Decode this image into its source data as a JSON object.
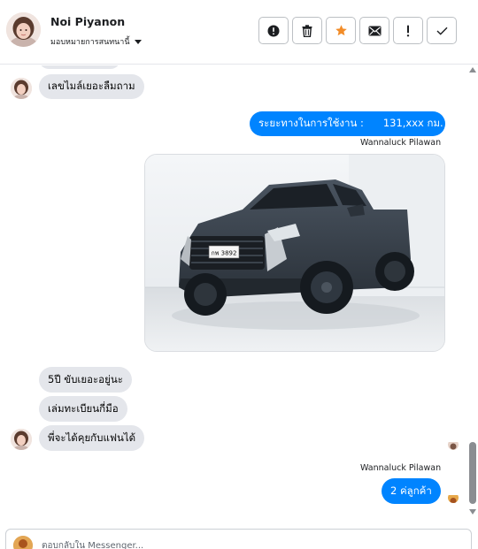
{
  "header": {
    "contact_name": "Noi Piyanon",
    "assign_label": "มอบหมายการสนทนานี้",
    "actions": [
      "exclamation-circle-icon",
      "trash-icon",
      "star-icon",
      "envelope-icon",
      "exclamation-icon",
      "check-icon"
    ]
  },
  "colors": {
    "accent": "#0084ff",
    "incoming_bubble": "#e4e6eb",
    "star": "#f28c28"
  },
  "messages": {
    "partial_top": "",
    "m1": "เลขไมล์เยอะลืมถาม",
    "m2": "ระยะทางในการใช้งาน :      131,xxx กม.",
    "m2_sender": "Wannaluck Pilawan",
    "photo_plate": "กพ 3892",
    "m3": "5ปี ขับเยอะอยู่นะ",
    "m4": "เล่มทะเบียนกี่มือ",
    "m5": "พี่จะได้คุยกับแฟนได้",
    "m6_sender": "Wannaluck Pilawan",
    "m6": "2 ค่ลูกค้า"
  },
  "composer": {
    "placeholder": "ตอบกลับใน Messenger..."
  }
}
